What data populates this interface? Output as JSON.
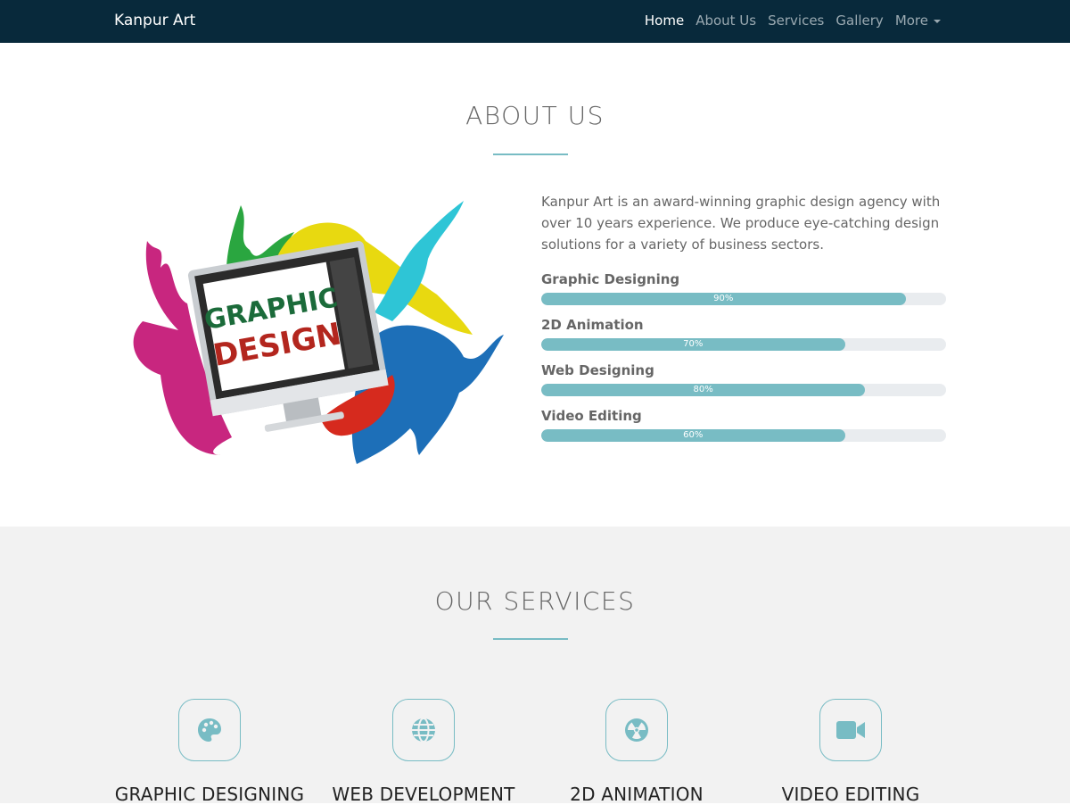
{
  "nav": {
    "brand": "Kanpur Art",
    "items": [
      {
        "label": "Home",
        "active": true
      },
      {
        "label": "About Us"
      },
      {
        "label": "Services"
      },
      {
        "label": "Gallery"
      },
      {
        "label": "More",
        "dropdown": true
      }
    ]
  },
  "about": {
    "title": "ABOUT US",
    "description": "Kanpur Art is an award-winning graphic design agency with over 10 years experience. We produce eye-catching design solutions for a variety of business sectors.",
    "image_text": [
      "GRAPHIC",
      "DESIGN"
    ],
    "skills": [
      {
        "label": "Graphic Designing",
        "percent": 90,
        "percent_label": "90%"
      },
      {
        "label": "2D Animation",
        "percent": 75,
        "percent_label": "70%"
      },
      {
        "label": "Web Designing",
        "percent": 80,
        "percent_label": "80%"
      },
      {
        "label": "Video Editing",
        "percent": 75,
        "percent_label": "60%"
      }
    ]
  },
  "services": {
    "title": "OUR SERVICES",
    "items": [
      {
        "title": "GRAPHIC DESIGNING",
        "icon": "palette-icon"
      },
      {
        "title": "WEB DEVELOPMENT",
        "icon": "globe-icon"
      },
      {
        "title": "2D ANIMATION",
        "icon": "radiation-icon"
      },
      {
        "title": "VIDEO EDITING",
        "icon": "video-camera-icon"
      }
    ]
  },
  "colors": {
    "navbar": "#08293b",
    "accent": "#78bcc4",
    "services_bg": "#f2f2f2"
  }
}
